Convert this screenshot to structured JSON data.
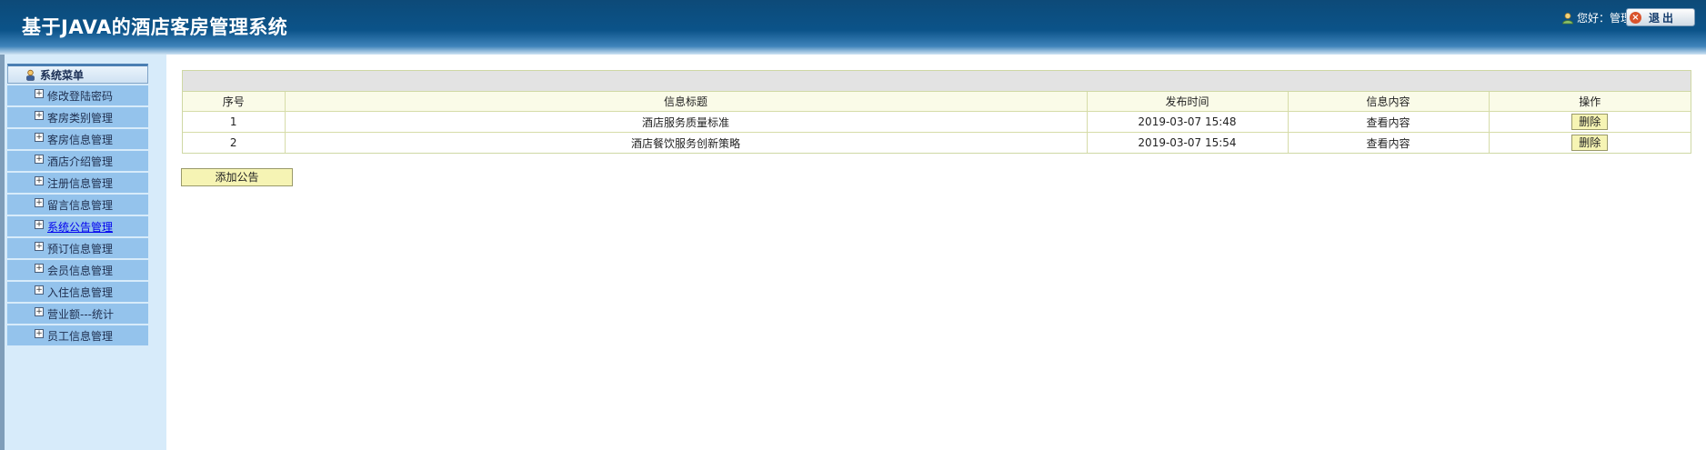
{
  "header": {
    "title": "基于JAVA的酒店客房管理系统",
    "greeting": "您好：管理员",
    "logout_label": "退出"
  },
  "sidebar": {
    "menu_title": "系统菜单",
    "items": [
      {
        "label": "修改登陆密码"
      },
      {
        "label": "客房类别管理"
      },
      {
        "label": "客房信息管理"
      },
      {
        "label": "酒店介绍管理"
      },
      {
        "label": "注册信息管理"
      },
      {
        "label": "留言信息管理"
      },
      {
        "label": "系统公告管理",
        "active": true
      },
      {
        "label": "预订信息管理"
      },
      {
        "label": "会员信息管理"
      },
      {
        "label": "入住信息管理"
      },
      {
        "label": "营业额---统计"
      },
      {
        "label": "员工信息管理"
      }
    ]
  },
  "table": {
    "columns": [
      "序号",
      "信息标题",
      "发布时间",
      "信息内容",
      "操作"
    ],
    "rows": [
      {
        "index": "1",
        "title": "酒店服务质量标准",
        "time": "2019-03-07 15:48",
        "content": "查看内容",
        "action": "删除"
      },
      {
        "index": "2",
        "title": "酒店餐饮服务创新策略",
        "time": "2019-03-07 15:54",
        "content": "查看内容",
        "action": "删除"
      }
    ]
  },
  "add_button_label": "添加公告",
  "colors": {
    "header_dark": "#0d4a78",
    "sidebar_bg": "#d7ebfa",
    "menu_item_bg": "#94c3ec",
    "button_yellow": "#f6f4b4",
    "table_header_bg": "#fafbe8",
    "active_link": "#0000ee"
  }
}
